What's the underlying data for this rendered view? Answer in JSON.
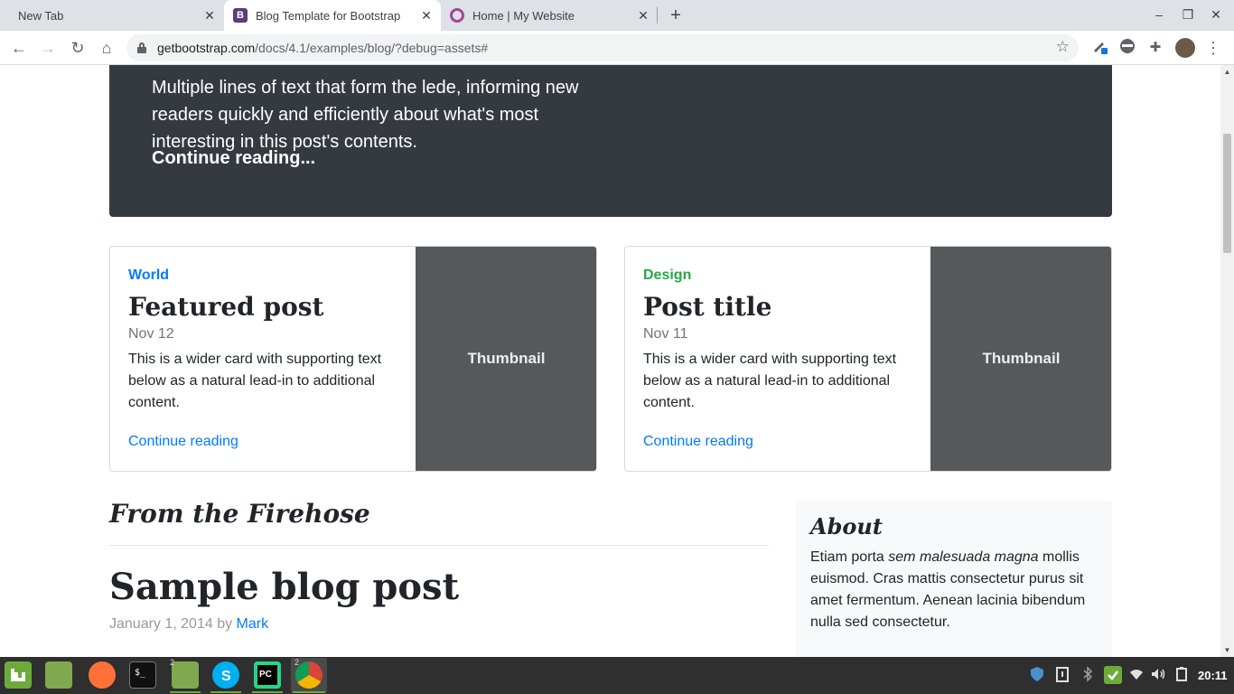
{
  "browser": {
    "tabs": [
      {
        "title": "New Tab",
        "close": "✕"
      },
      {
        "title": "Blog Template for Bootstrap",
        "close": "✕",
        "favicon": "B"
      },
      {
        "title": "Home | My Website",
        "close": "✕"
      }
    ],
    "new_tab": "+",
    "controls": {
      "minimize": "–",
      "maximize": "❐",
      "close": "✕"
    },
    "nav": {
      "back": "←",
      "forward": "→",
      "reload": "↻",
      "home": "⌂"
    },
    "url_host": "getbootstrap.com",
    "url_path": "/docs/4.1/examples/blog/?debug=assets#",
    "bookmark": "☆",
    "extensions": {
      "puzzle": "✚",
      "menu": "⋮"
    }
  },
  "page": {
    "jumbotron": {
      "lede": "Multiple lines of text that form the lede, informing new readers quickly and efficiently about what's most interesting in this post's contents.",
      "link": "Continue reading..."
    },
    "cards": [
      {
        "category": "World",
        "category_color": "#007bff",
        "title": "Featured post",
        "date": "Nov 12",
        "text": "This is a wider card with supporting text below as a natural lead-in to additional content.",
        "link": "Continue reading",
        "thumb": "Thumbnail"
      },
      {
        "category": "Design",
        "category_color": "#28a745",
        "title": "Post title",
        "date": "Nov 11",
        "text": "This is a wider card with supporting text below as a natural lead-in to additional content.",
        "link": "Continue reading",
        "thumb": "Thumbnail"
      }
    ],
    "section_heading": "From the Firehose",
    "post": {
      "title": "Sample blog post",
      "date": "January 1, 2014 by",
      "author": "Mark"
    },
    "about": {
      "title": "About",
      "text_1": "Etiam porta ",
      "text_em": "sem malesuada magna",
      "text_2": " mollis euismod. Cras mattis consectetur purus sit amet fermentum. Aenean lacinia bibendum nulla sed consectetur."
    }
  },
  "taskbar": {
    "counts": {
      "files": "2",
      "chrome": "2"
    },
    "clock": "20:11"
  }
}
